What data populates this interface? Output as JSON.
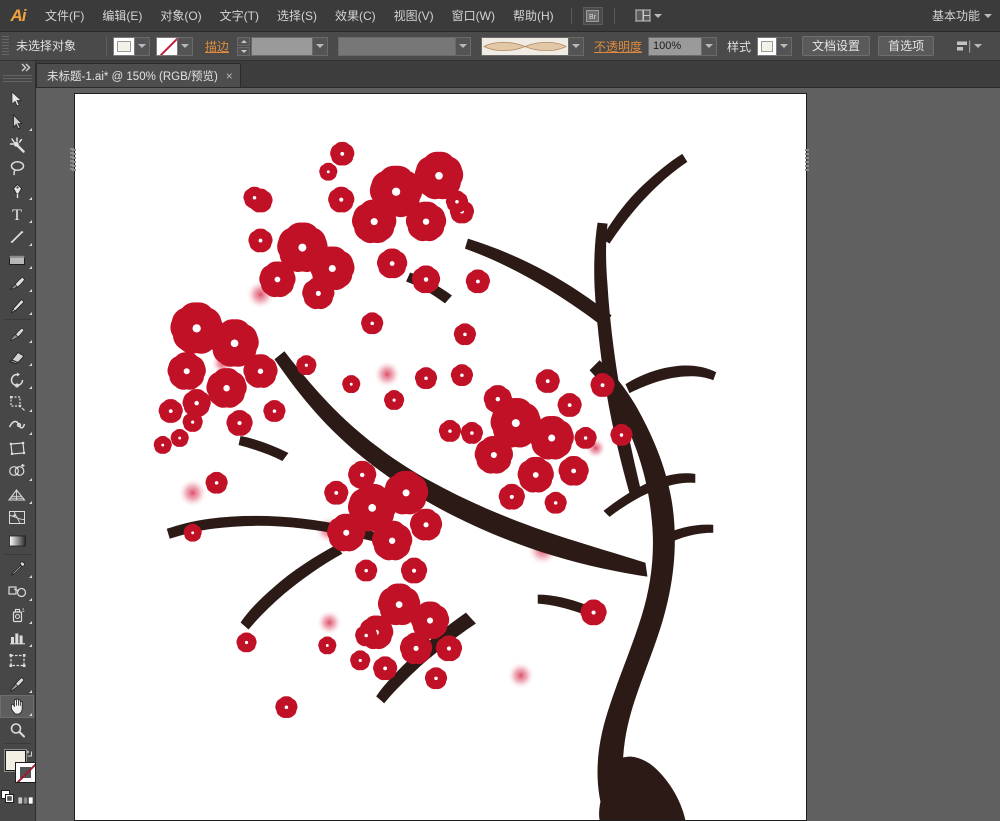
{
  "app": {
    "name": "Ai",
    "logo_color": "#f0a33c"
  },
  "menubar": {
    "items": [
      {
        "label": "文件(F)",
        "name": "menu-file"
      },
      {
        "label": "编辑(E)",
        "name": "menu-edit"
      },
      {
        "label": "对象(O)",
        "name": "menu-object"
      },
      {
        "label": "文字(T)",
        "name": "menu-type"
      },
      {
        "label": "选择(S)",
        "name": "menu-select"
      },
      {
        "label": "效果(C)",
        "name": "menu-effect"
      },
      {
        "label": "视图(V)",
        "name": "menu-view"
      },
      {
        "label": "窗口(W)",
        "name": "menu-window"
      },
      {
        "label": "帮助(H)",
        "name": "menu-help"
      }
    ],
    "bridge_icon": "bridge-icon",
    "arrange_icon": "arrange-documents-icon",
    "workspace": "基本功能"
  },
  "controlbar": {
    "selection_status": "未选择对象",
    "fill_label": "fill-swatch",
    "stroke_label": "stroke-swatch",
    "stroke_text": "描边",
    "stroke_weight_value": "",
    "brush_definition_value": "",
    "stroke_profile": "stroke-profile-swatch",
    "opacity_label": "不透明度",
    "opacity_value": "100%",
    "style_label": "样式",
    "document_setup_button": "文档设置",
    "preferences_button": "首选项",
    "align_icon": "align-to-selection-icon"
  },
  "tabbar": {
    "document_title": "未标题-1.ai* @ 150% (RGB/预览)",
    "close_glyph": "×"
  },
  "toolbar": {
    "tools": [
      {
        "name": "selection-tool",
        "icon": "arrow-solid",
        "corner": false,
        "selected": false
      },
      {
        "name": "direct-selection-tool",
        "icon": "arrow-hollow",
        "corner": true,
        "selected": false
      },
      {
        "name": "magic-wand-tool",
        "icon": "magic-wand",
        "corner": false,
        "selected": false
      },
      {
        "name": "lasso-tool",
        "icon": "lasso",
        "corner": false,
        "selected": false
      },
      {
        "name": "pen-tool",
        "icon": "pen",
        "corner": true,
        "selected": false
      },
      {
        "name": "type-tool",
        "icon": "type-T",
        "corner": true,
        "selected": false
      },
      {
        "name": "line-segment-tool",
        "icon": "line-segment",
        "corner": true,
        "selected": false
      },
      {
        "name": "rectangle-tool",
        "icon": "rectangle",
        "corner": true,
        "selected": false
      },
      {
        "name": "paintbrush-tool",
        "icon": "paintbrush",
        "corner": true,
        "selected": false
      },
      {
        "name": "pencil-tool",
        "icon": "pencil",
        "corner": true,
        "selected": false
      },
      {
        "name": "blob-brush-tool",
        "icon": "blob-brush",
        "corner": true,
        "selected": false
      },
      {
        "name": "eraser-tool",
        "icon": "eraser",
        "corner": true,
        "selected": false
      },
      {
        "name": "rotate-tool",
        "icon": "rotate",
        "corner": true,
        "selected": false
      },
      {
        "name": "scale-tool",
        "icon": "scale",
        "corner": true,
        "selected": false
      },
      {
        "name": "width-tool",
        "icon": "width-warp",
        "corner": true,
        "selected": false
      },
      {
        "name": "free-transform-tool",
        "icon": "free-transform",
        "corner": false,
        "selected": false
      },
      {
        "name": "shape-builder-tool",
        "icon": "shape-builder",
        "corner": true,
        "selected": false
      },
      {
        "name": "perspective-grid-tool",
        "icon": "perspective-grid",
        "corner": true,
        "selected": false
      },
      {
        "name": "mesh-tool",
        "icon": "mesh",
        "corner": false,
        "selected": false
      },
      {
        "name": "gradient-tool",
        "icon": "gradient",
        "corner": false,
        "selected": false
      },
      {
        "name": "eyedropper-tool",
        "icon": "eyedropper",
        "corner": true,
        "selected": false
      },
      {
        "name": "blend-tool",
        "icon": "blend",
        "corner": true,
        "selected": false
      },
      {
        "name": "symbol-sprayer-tool",
        "icon": "symbol-sprayer",
        "corner": true,
        "selected": false
      },
      {
        "name": "column-graph-tool",
        "icon": "column-graph",
        "corner": true,
        "selected": false
      },
      {
        "name": "artboard-tool",
        "icon": "artboard",
        "corner": false,
        "selected": false
      },
      {
        "name": "slice-tool",
        "icon": "slice",
        "corner": true,
        "selected": false
      },
      {
        "name": "hand-tool",
        "icon": "hand",
        "corner": true,
        "selected": true
      },
      {
        "name": "zoom-tool",
        "icon": "magnifier",
        "corner": false,
        "selected": false
      }
    ],
    "fill_color": "#f2efe4",
    "stroke_color": "none",
    "fill_swatch_name": "fill-color-swatch",
    "stroke_swatch_name": "stroke-color-swatch"
  },
  "canvas": {
    "background_color": "#606060",
    "artboard_color": "#ffffff",
    "zoom_level": "150%",
    "color_mode": "RGB/预览"
  },
  "artwork": {
    "title": "cherry-blossom-branch",
    "branch_color": "#2b1a16",
    "petal_color": "#c01127",
    "petal_dark": "#8f0c1d",
    "glow_color": "#e26b7e",
    "center_color": "#ffffff"
  }
}
